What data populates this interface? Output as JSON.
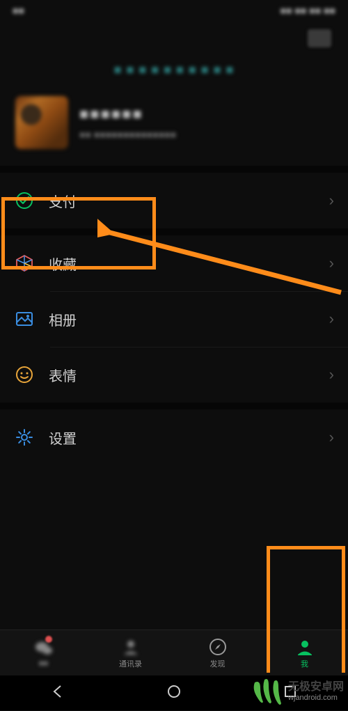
{
  "status": {
    "left": "■■",
    "right": "■■ ■■ ■■ ■■"
  },
  "banner_text": "■ ■ ■ ■ ■ ■ ■ ■ ■ ■",
  "profile": {
    "name": "■■■■■■",
    "id": "■■ ■■■■■■■■■■■■■■"
  },
  "menu": {
    "pay": {
      "label": "支付",
      "icon": "pay-icon"
    },
    "favorites": {
      "label": "收藏",
      "icon": "favorites-icon"
    },
    "album": {
      "label": "相册",
      "icon": "album-icon"
    },
    "stickers": {
      "label": "表情",
      "icon": "sticker-icon"
    },
    "settings": {
      "label": "设置",
      "icon": "settings-icon"
    }
  },
  "tabs": {
    "chat": {
      "label": "■■"
    },
    "contacts": {
      "label": "通讯录"
    },
    "discover": {
      "label": "发现"
    },
    "me": {
      "label": "我"
    }
  },
  "watermark": {
    "title": "无极安卓网",
    "url": "wjandroid.com"
  },
  "colors": {
    "accent": "#07c160",
    "highlight": "#ff8c1a"
  }
}
